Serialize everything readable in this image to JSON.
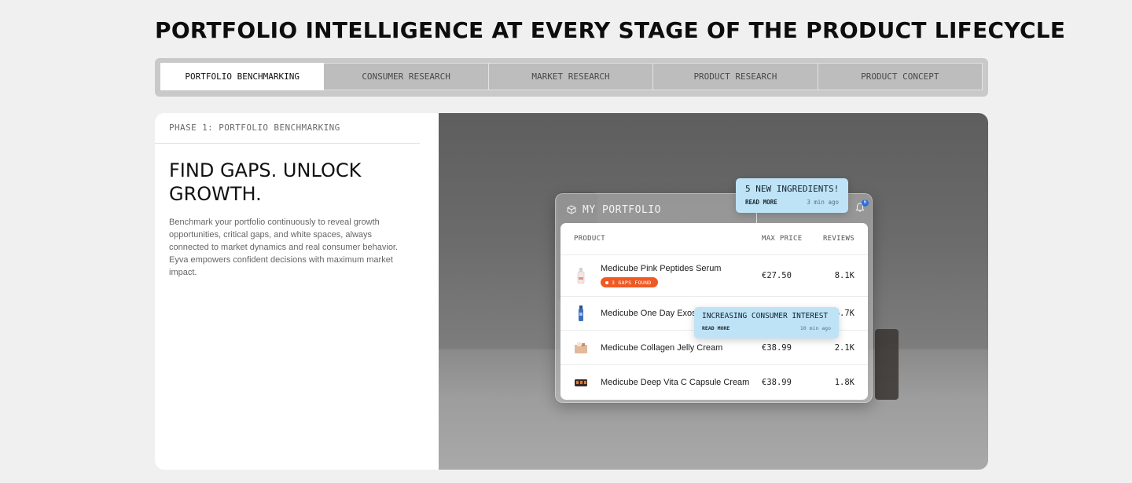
{
  "page": {
    "heading": "PORTFOLIO INTELLIGENCE AT EVERY STAGE OF THE PRODUCT LIFECYCLE"
  },
  "tabs": [
    {
      "label": "PORTFOLIO BENCHMARKING",
      "active": true
    },
    {
      "label": "CONSUMER RESEARCH",
      "active": false
    },
    {
      "label": "MARKET RESEARCH",
      "active": false
    },
    {
      "label": "PRODUCT RESEARCH",
      "active": false
    },
    {
      "label": "PRODUCT CONCEPT",
      "active": false
    }
  ],
  "phase": {
    "label": "PHASE 1: PORTFOLIO BENCHMARKING",
    "title": "FIND GAPS. UNLOCK GROWTH.",
    "description": "Benchmark your portfolio continuously to reveal growth opportunities, critical gaps, and white spaces, always connected to market dynamics and real consumer behavior. Eyva empowers confident decisions with maximum market impact."
  },
  "portfolio": {
    "title": "MY PORTFOLIO",
    "notification_count": "6",
    "columns": {
      "product": "PRODUCT",
      "price": "MAX PRICE",
      "reviews": "REVIEWS"
    },
    "rows": [
      {
        "name": "Medicube Pink Peptides Serum",
        "badge": "3 GAPS FOUND",
        "price": "€27.50",
        "reviews": "8.1K",
        "thumb_icon": "serum-bottle-icon"
      },
      {
        "name": "Medicube One Day Exoso",
        "badge": "",
        "price": "",
        "reviews": "6.7K",
        "thumb_icon": "blue-bottle-icon"
      },
      {
        "name": "Medicube Collagen Jelly Cream",
        "badge": "",
        "price": "€38.99",
        "reviews": "2.1K",
        "thumb_icon": "cream-jar-icon"
      },
      {
        "name": "Medicube Deep Vita C Capsule Cream",
        "badge": "",
        "price": "€38.99",
        "reviews": "1.8K",
        "thumb_icon": "capsule-cream-icon"
      }
    ]
  },
  "callouts": {
    "ingredients": {
      "title": "5 NEW INGREDIENTS!",
      "read_more": "READ MORE",
      "time": "3 min ago"
    },
    "interest": {
      "title": "INCREASING CONSUMER INTEREST",
      "read_more": "READ MORE",
      "time": "10 min ago"
    }
  },
  "colors": {
    "badge_orange": "#ef5a24",
    "callout_blue": "#bfe3f6",
    "notification_blue": "#2b6fe0"
  }
}
